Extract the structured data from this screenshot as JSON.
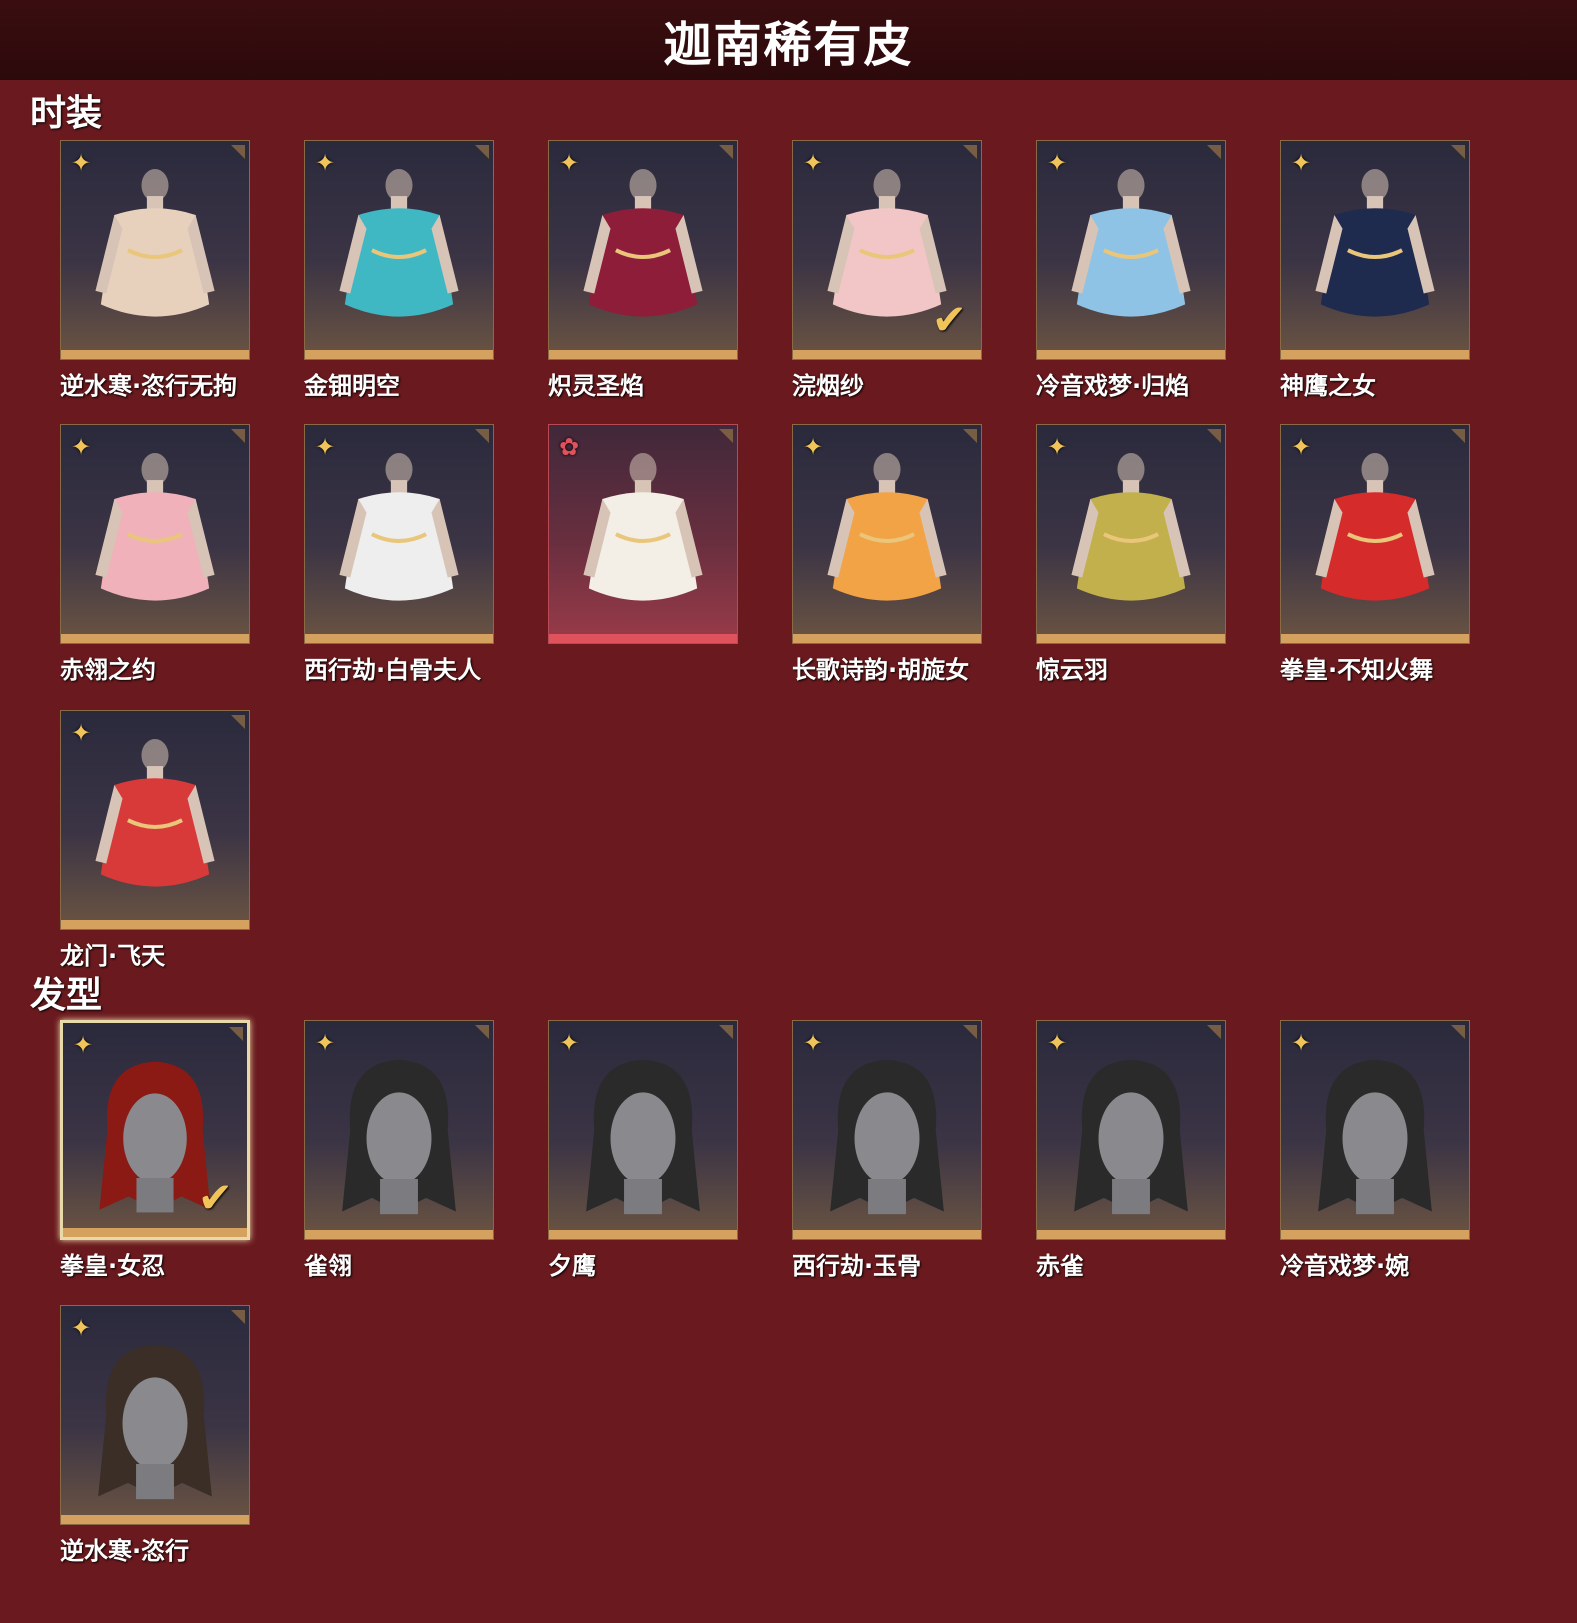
{
  "header": {
    "title": "迦南稀有皮"
  },
  "sections": [
    {
      "title": "时装",
      "items": [
        {
          "label": "逆水寒·恣行无拘",
          "rarity": "gold",
          "selected": true,
          "color": "#e7d1bd"
        },
        {
          "label": "金钿明空",
          "rarity": "gold",
          "selected": false,
          "color": "#3fb8c4"
        },
        {
          "label": "炽灵圣焰",
          "rarity": "gold",
          "selected": false,
          "color": "#8e1d3a"
        },
        {
          "label": "浣烟纱",
          "rarity": "gold",
          "selected": true,
          "color": "#f2c6c6"
        },
        {
          "label": "冷音戏梦·归焰",
          "rarity": "gold",
          "selected": false,
          "color": "#8ec3e6"
        },
        {
          "label": "神鹰之女",
          "rarity": "gold",
          "selected": false,
          "color": "#1f2a4f"
        },
        {
          "label": "赤翎之约",
          "rarity": "gold",
          "selected": false,
          "color": "#f0b1ba"
        },
        {
          "label": "西行劫·白骨夫人",
          "rarity": "gold",
          "selected": false,
          "color": "#eeeeee"
        },
        {
          "label": "",
          "rarity": "red",
          "selected": false,
          "color": "#f4efe6"
        },
        {
          "label": "长歌诗韵·胡旋女",
          "rarity": "gold",
          "selected": false,
          "color": "#f2a346"
        },
        {
          "label": "惊云羽",
          "rarity": "gold",
          "selected": false,
          "color": "#c2b04c"
        },
        {
          "label": "拳皇·不知火舞",
          "rarity": "gold",
          "selected": false,
          "color": "#d62b2b"
        },
        {
          "label": "龙门·飞天",
          "rarity": "gold",
          "selected": false,
          "color": "#d83a3a"
        }
      ]
    },
    {
      "title": "发型",
      "items": [
        {
          "label": "拳皇·女忍",
          "rarity": "gold",
          "selected": true,
          "color": "#8b1a14"
        },
        {
          "label": "雀翎",
          "rarity": "gold",
          "selected": false,
          "color": "#2a2a2a"
        },
        {
          "label": "夕鹰",
          "rarity": "gold",
          "selected": false,
          "color": "#2a2a2a"
        },
        {
          "label": "西行劫·玉骨",
          "rarity": "gold",
          "selected": false,
          "color": "#2a2a2a"
        },
        {
          "label": "赤雀",
          "rarity": "gold",
          "selected": false,
          "color": "#2a2a2a"
        },
        {
          "label": "冷音戏梦·婉",
          "rarity": "gold",
          "selected": false,
          "color": "#2a2a2a"
        },
        {
          "label": "逆水寒·恣行",
          "rarity": "gold",
          "selected": false,
          "color": "#3a2e26"
        }
      ]
    }
  ],
  "icons": {
    "rarity_gold": "four-petal-flower-icon",
    "rarity_red": "red-flower-icon",
    "owned": "check-icon",
    "corner": "corner-fold-icon"
  }
}
